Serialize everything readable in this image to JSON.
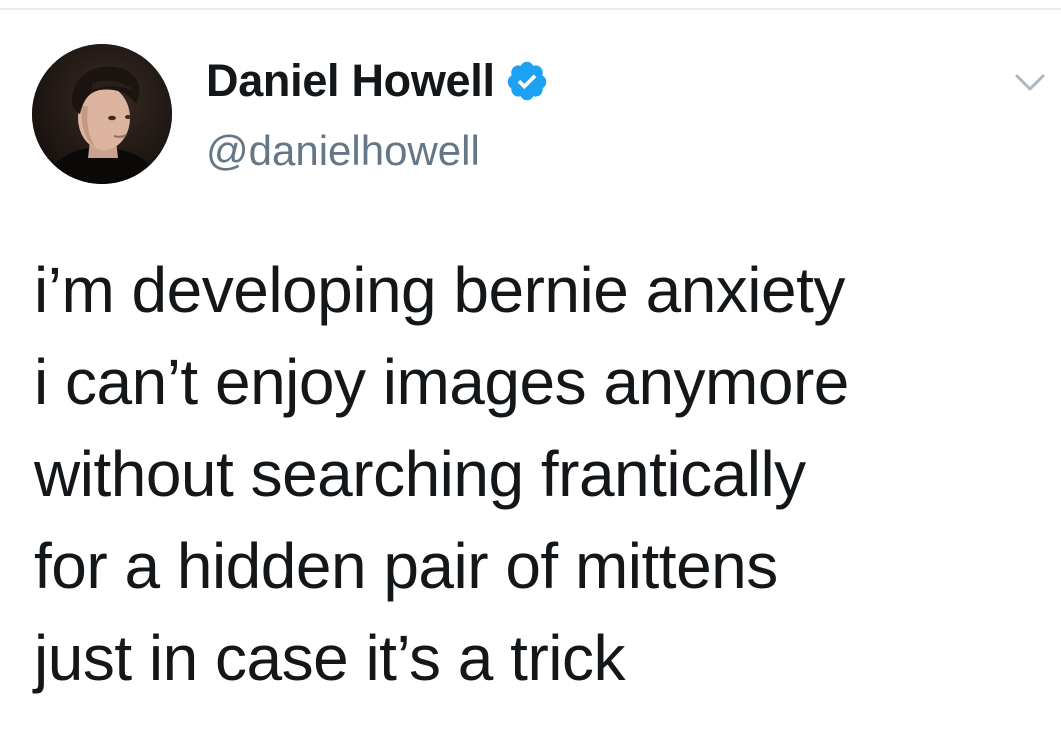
{
  "author": {
    "display_name": "Daniel Howell",
    "handle": "@danielhowell",
    "verified": true,
    "avatar_icon": "profile-photo"
  },
  "tweet": {
    "lines": [
      "i’m developing bernie anxiety",
      "i can’t enjoy images anymore",
      "without searching frantically",
      "for a hidden pair of mittens",
      "just in case it’s a trick"
    ]
  },
  "icons": {
    "verified": "verified-badge-icon",
    "menu": "chevron-down-icon"
  },
  "colors": {
    "text": "#14171a",
    "handle": "#657786",
    "verified_badge": "#1da1f2",
    "caret": "#aab8c2"
  }
}
